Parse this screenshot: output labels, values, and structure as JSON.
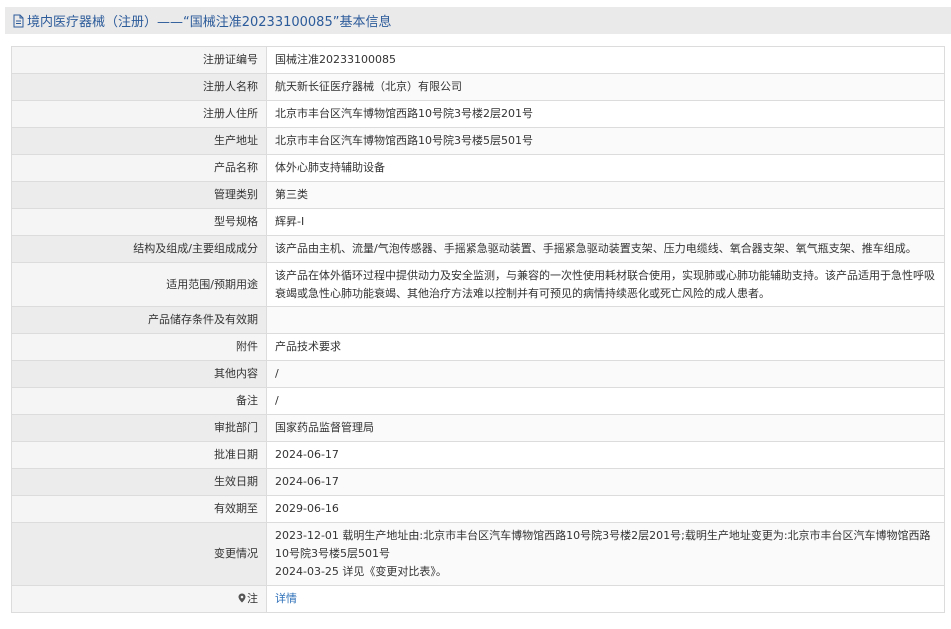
{
  "header": {
    "title": "境内医疗器械（注册）——“国械注准20233100085”基本信息"
  },
  "rows": [
    {
      "label": "注册证编号",
      "value": "国械注准20233100085"
    },
    {
      "label": "注册人名称",
      "value": "航天新长征医疗器械（北京）有限公司"
    },
    {
      "label": "注册人住所",
      "value": "北京市丰台区汽车博物馆西路10号院3号楼2层201号"
    },
    {
      "label": "生产地址",
      "value": "北京市丰台区汽车博物馆西路10号院3号楼5层501号"
    },
    {
      "label": "产品名称",
      "value": "体外心肺支持辅助设备"
    },
    {
      "label": "管理类别",
      "value": "第三类"
    },
    {
      "label": "型号规格",
      "value": "辉昇-I"
    },
    {
      "label": "结构及组成/主要组成成分",
      "value": "该产品由主机、流量/气泡传感器、手摇紧急驱动装置、手摇紧急驱动装置支架、压力电缆线、氧合器支架、氧气瓶支架、推车组成。"
    },
    {
      "label": "适用范围/预期用途",
      "value": "该产品在体外循环过程中提供动力及安全监测，与兼容的一次性使用耗材联合使用，实现肺或心肺功能辅助支持。该产品适用于急性呼吸衰竭或急性心肺功能衰竭、其他治疗方法难以控制并有可预见的病情持续恶化或死亡风险的成人患者。"
    },
    {
      "label": "产品储存条件及有效期",
      "value": ""
    },
    {
      "label": "附件",
      "value": "产品技术要求"
    },
    {
      "label": "其他内容",
      "value": "/"
    },
    {
      "label": "备注",
      "value": "/"
    },
    {
      "label": "审批部门",
      "value": "国家药品监督管理局"
    },
    {
      "label": "批准日期",
      "value": "2024-06-17"
    },
    {
      "label": "生效日期",
      "value": "2024-06-17"
    },
    {
      "label": "有效期至",
      "value": "2029-06-16"
    }
  ],
  "changes": {
    "label": "变更情况",
    "line1": "2023-12-01 载明生产地址由:北京市丰台区汽车博物馆西路10号院3号楼2层201号;载明生产地址变更为:北京市丰台区汽车博物馆西路10号院3号楼5层501号",
    "line2": "2024-03-25 详见《变更对比表》。"
  },
  "note": {
    "label": "注",
    "link": "详情",
    "icon": "pin-icon"
  },
  "colors": {
    "header_text": "#2c5b9a",
    "link": "#2c6fb8",
    "border": "#dcdcdc"
  }
}
